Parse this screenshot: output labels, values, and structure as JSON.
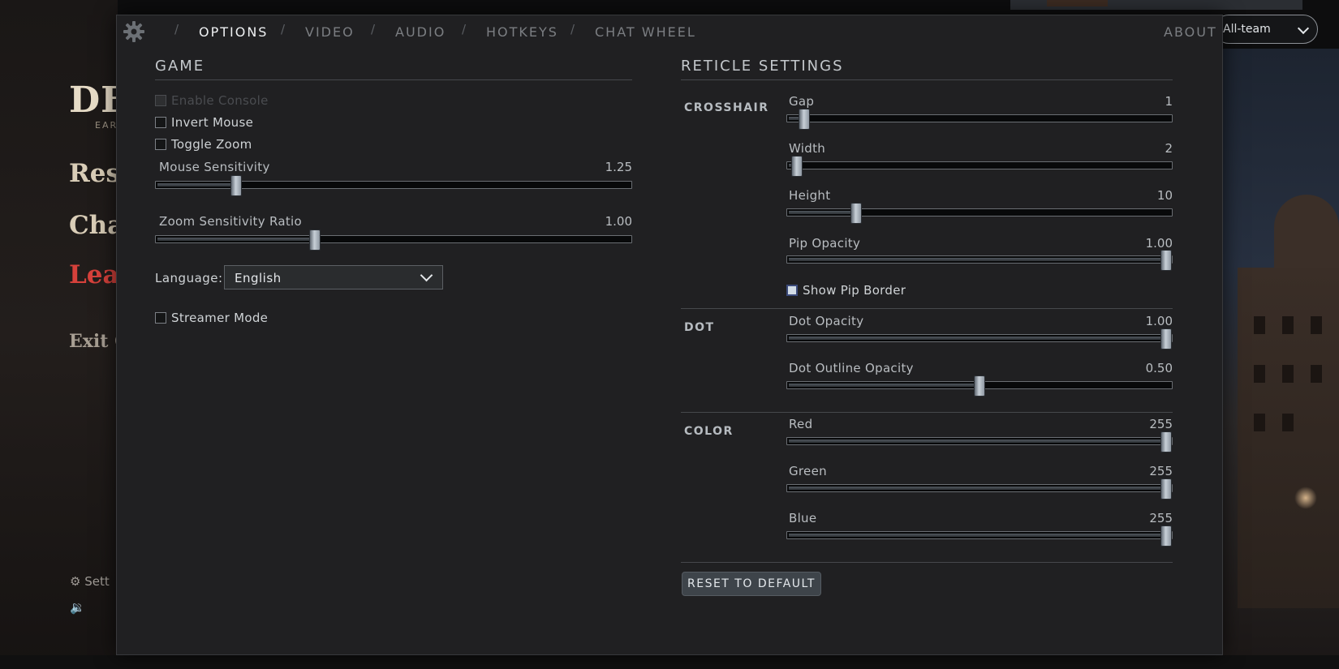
{
  "background": {
    "logo": "DE",
    "logo_sub": "EARL",
    "menu_items": [
      "Res",
      "Cha",
      "Leav",
      "Exit G"
    ],
    "footer_settings": "⚙ Sett",
    "footer_audio": "🔉"
  },
  "chat_select": {
    "value": "All-team",
    "icon": "chevron-down-icon"
  },
  "nav": {
    "gear_icon": "gear-icon",
    "tabs": [
      "OPTIONS",
      "VIDEO",
      "AUDIO",
      "HOTKEYS",
      "CHAT WHEEL"
    ],
    "active_tab": "OPTIONS",
    "about": "ABOUT",
    "separator": "/"
  },
  "game": {
    "title": "GAME",
    "checkboxes": [
      {
        "label": "Enable Console",
        "checked": false,
        "disabled": true
      },
      {
        "label": "Invert Mouse",
        "checked": false,
        "disabled": false
      },
      {
        "label": "Toggle Zoom",
        "checked": false,
        "disabled": false
      }
    ],
    "sliders": [
      {
        "label": "Mouse Sensitivity",
        "value": "1.25",
        "fraction": 0.16
      },
      {
        "label": "Zoom Sensitivity Ratio",
        "value": "1.00",
        "fraction": 0.33
      }
    ],
    "language_label": "Language:",
    "language_value": "English",
    "streamer_mode": {
      "label": "Streamer Mode",
      "checked": false
    }
  },
  "reticle": {
    "title": "RETICLE SETTINGS",
    "crosshair": {
      "label": "CROSSHAIR",
      "sliders": [
        {
          "label": "Gap",
          "value": "1",
          "fraction": 0.03
        },
        {
          "label": "Width",
          "value": "2",
          "fraction": 0.01
        },
        {
          "label": "Height",
          "value": "10",
          "fraction": 0.17
        },
        {
          "label": "Pip Opacity",
          "value": "1.00",
          "fraction": 1.0
        }
      ],
      "show_pip_border": {
        "label": "Show Pip Border",
        "checked": true
      }
    },
    "dot": {
      "label": "DOT",
      "sliders": [
        {
          "label": "Dot Opacity",
          "value": "1.00",
          "fraction": 1.0
        },
        {
          "label": "Dot Outline Opacity",
          "value": "0.50",
          "fraction": 0.5
        }
      ]
    },
    "color": {
      "label": "COLOR",
      "sliders": [
        {
          "label": "Red",
          "value": "255",
          "fraction": 1.0
        },
        {
          "label": "Green",
          "value": "255",
          "fraction": 1.0
        },
        {
          "label": "Blue",
          "value": "255",
          "fraction": 1.0
        }
      ]
    },
    "reset_label": "RESET TO DEFAULT"
  }
}
